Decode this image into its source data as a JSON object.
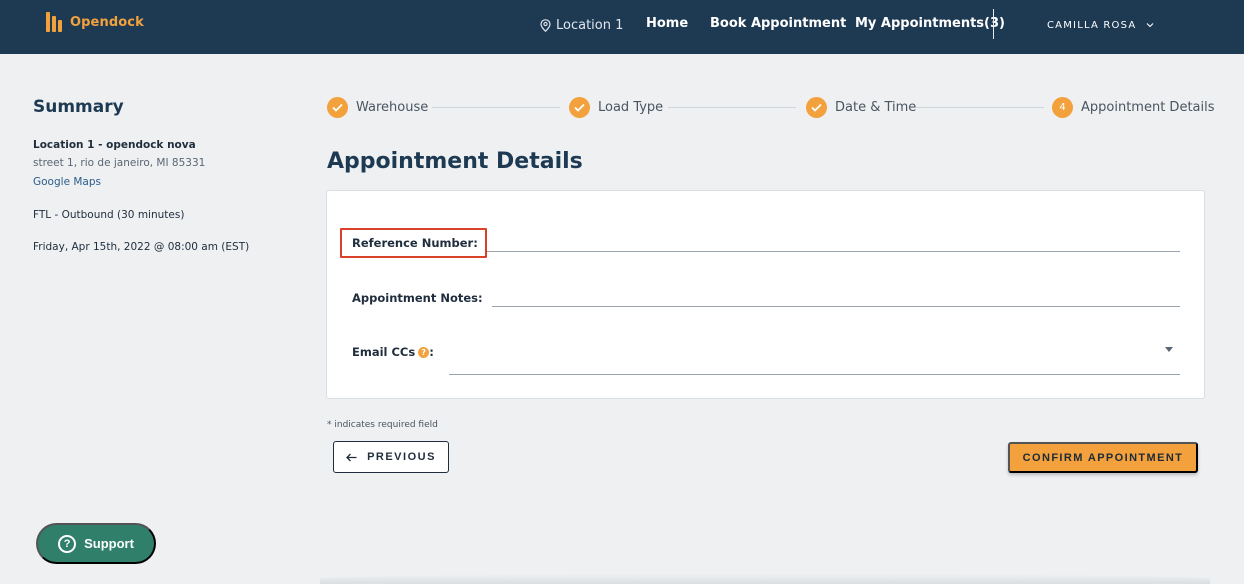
{
  "header": {
    "brand": "Opendock",
    "location": "Location 1",
    "nav": {
      "home": "Home",
      "book": "Book Appointment",
      "my_appointments": "My Appointments(3)"
    },
    "user": "CAMILLA ROSA"
  },
  "summary": {
    "title": "Summary",
    "warehouse_name": "Location 1 - opendock nova",
    "address": "street 1, rio de janeiro, MI 85331",
    "map_link": "Google Maps",
    "load_type": "FTL - Outbound (30 minutes)",
    "datetime": "Friday, Apr 15th, 2022 @ 08:00 am (EST)"
  },
  "stepper": {
    "steps": [
      {
        "label": "Warehouse",
        "state": "complete"
      },
      {
        "label": "Load Type",
        "state": "complete"
      },
      {
        "label": "Date & Time",
        "state": "complete"
      },
      {
        "label": "Appointment Details",
        "state": "current",
        "number": "4"
      }
    ]
  },
  "main": {
    "title": "Appointment Details",
    "fields": {
      "reference_label": "Reference Number:",
      "reference_value": "",
      "notes_label": "Appointment Notes:",
      "notes_value": "",
      "email_label": "Email CCs",
      "email_suffix": ":",
      "email_value": ""
    },
    "required_note": "* indicates required field",
    "previous_label": "PREVIOUS",
    "confirm_label": "CONFIRM APPOINTMENT"
  },
  "support": {
    "label": "Support"
  },
  "colors": {
    "header_bg": "#1e3a53",
    "accent": "#f3a13d",
    "support_bg": "#2f7f6b",
    "highlight": "#d9412b"
  }
}
